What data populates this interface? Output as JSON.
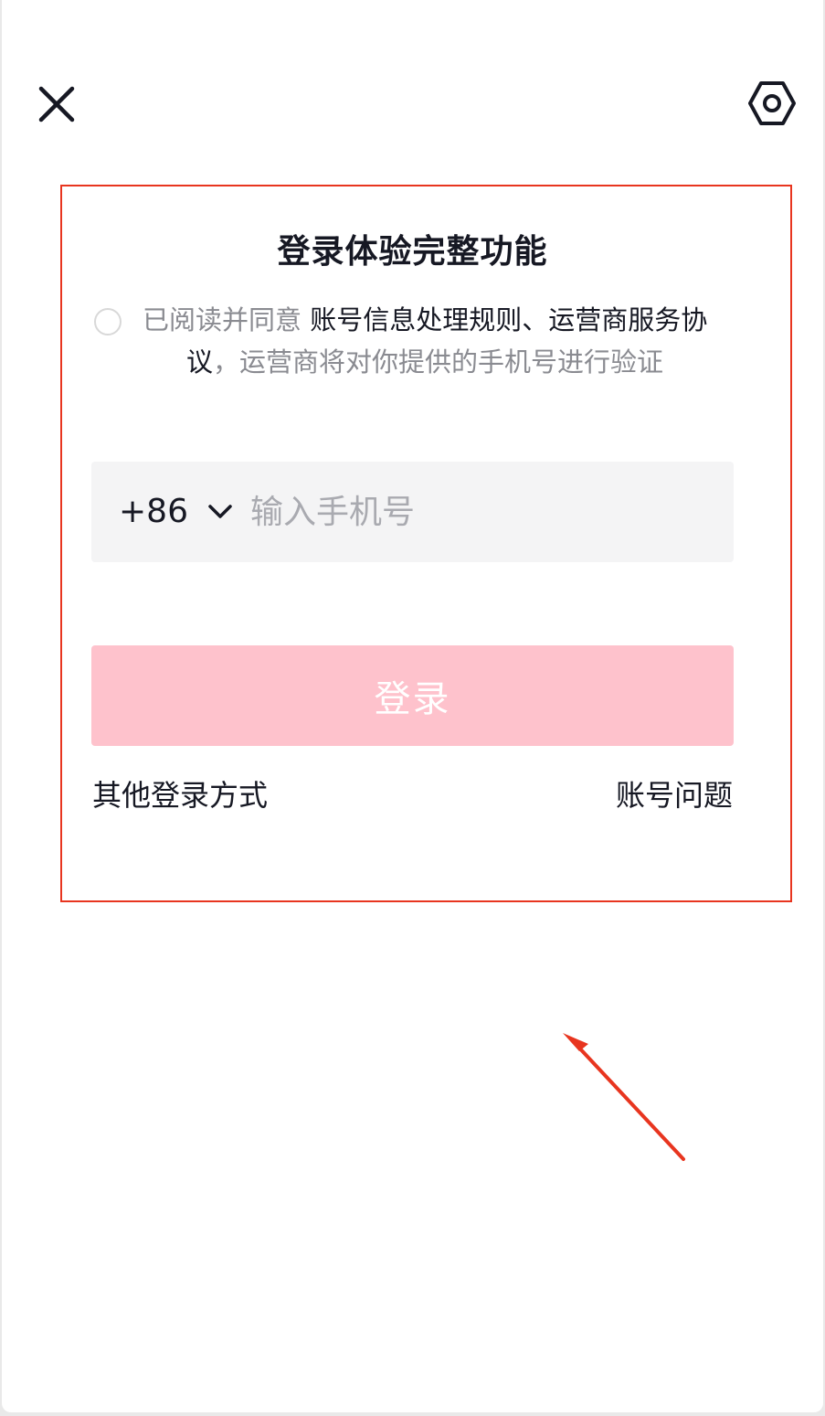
{
  "header": {
    "close_icon": "close-icon",
    "settings_icon": "hexagon-settings-icon"
  },
  "login": {
    "title": "登录体验完整功能",
    "agreement": {
      "prefix": "已阅读并同意 ",
      "link_rules": "账号信息处理规则",
      "separator": "、",
      "link_operator_line1": "运营商服务协",
      "link_operator_line2": "议",
      "suffix": "，运营商将对你提供的手机号进行验证"
    },
    "phone": {
      "country_code": "+86",
      "value": "",
      "placeholder": "输入手机号"
    },
    "submit_label": "登录",
    "other_methods_label": "其他登录方式",
    "account_issue_label": "账号问题"
  },
  "colors": {
    "highlight_border": "#e8351f",
    "login_button": "#fec2cc",
    "input_background": "#f4f4f5",
    "arrow": "#e8351f"
  }
}
